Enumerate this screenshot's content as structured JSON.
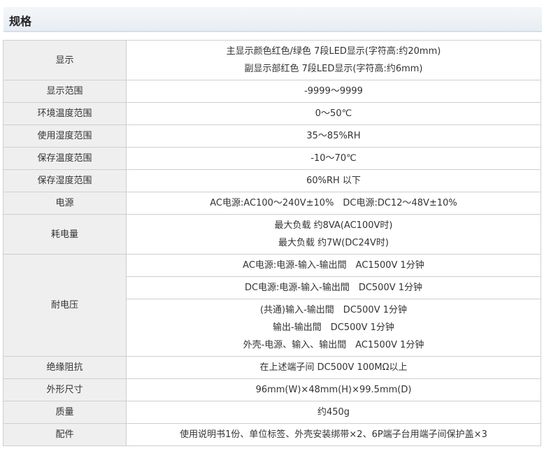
{
  "section": {
    "title": "规格"
  },
  "spec": {
    "display": {
      "label": "显示",
      "lines": [
        "主显示颜色红色/绿色 7段LED显示(字符高:约20mm)",
        "副显示部红色 7段LED显示(字符高:约6mm)"
      ]
    },
    "display_range": {
      "label": "显示范围",
      "value": "-9999～9999"
    },
    "ambient_temp": {
      "label": "环境温度范围",
      "value": "0～50℃"
    },
    "operating_humidity": {
      "label": "使用湿度范围",
      "value": "35～85%RH"
    },
    "storage_temp": {
      "label": "保存温度范围",
      "value": "-10～70℃"
    },
    "storage_humidity": {
      "label": "保存湿度范围",
      "value": "60%RH 以下"
    },
    "power": {
      "label": "电源",
      "value": "AC电源:AC100～240V±10%　DC电源:DC12～48V±10%"
    },
    "consumption": {
      "label": "耗电量",
      "lines": [
        "最大负载 约8VA(AC100V时)",
        "最大负载 约7W(DC24V时)"
      ]
    },
    "withstand": {
      "label": "耐电压",
      "ac": "AC电源:电源-输入-输出間　AC1500V 1分钟",
      "dc": "DC电源:电源-输入-输出間　DC500V 1分钟",
      "common_lines": [
        "(共通)输入-输出間　DC500V 1分钟",
        "输出-输出間　DC500V 1分钟",
        "外壳-电源、输入、输出間　AC1500V 1分钟"
      ]
    },
    "insulation": {
      "label": "绝缘阻抗",
      "value": "在上述端子间 DC500V 100MΩ以上"
    },
    "dimensions": {
      "label": "外形尺寸",
      "value": "96mm(W)×48mm(H)×99.5mm(D)"
    },
    "weight": {
      "label": "质量",
      "value": "约450g"
    },
    "accessories": {
      "label": "配件",
      "value": "使用说明书1份、单位标签、外壳安装绑带×2、6P端子台用端子间保护盖×3"
    }
  }
}
